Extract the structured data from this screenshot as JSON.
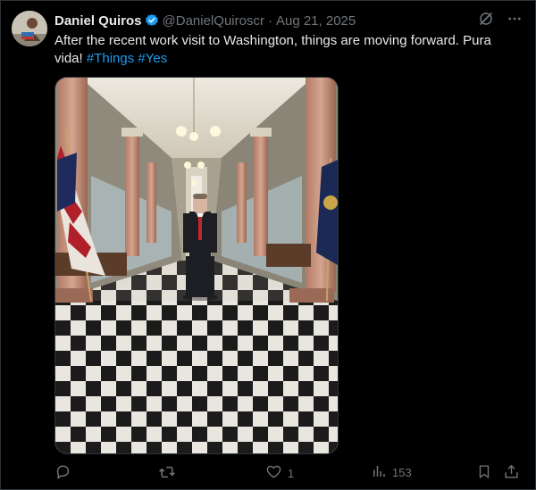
{
  "author": {
    "name": "Daniel Quiros",
    "handle": "@DanielQuiroscr",
    "separator": "·",
    "date": "Aug 21, 2025"
  },
  "tweet": {
    "text_main": "After the recent work visit to Washington, things are moving forward. Pura vida!",
    "hashtags": [
      "#Things",
      "#Yes"
    ]
  },
  "actions": {
    "likes": "1",
    "views": "153"
  },
  "colors": {
    "background": "#000000",
    "text": "#e7e9ea",
    "muted": "#71767b",
    "accent": "#1d9bf0"
  },
  "icons": [
    "verified-badge-icon",
    "grok-icon",
    "more-icon",
    "reply-icon",
    "retweet-icon",
    "like-icon",
    "views-icon",
    "bookmark-icon",
    "share-icon"
  ]
}
